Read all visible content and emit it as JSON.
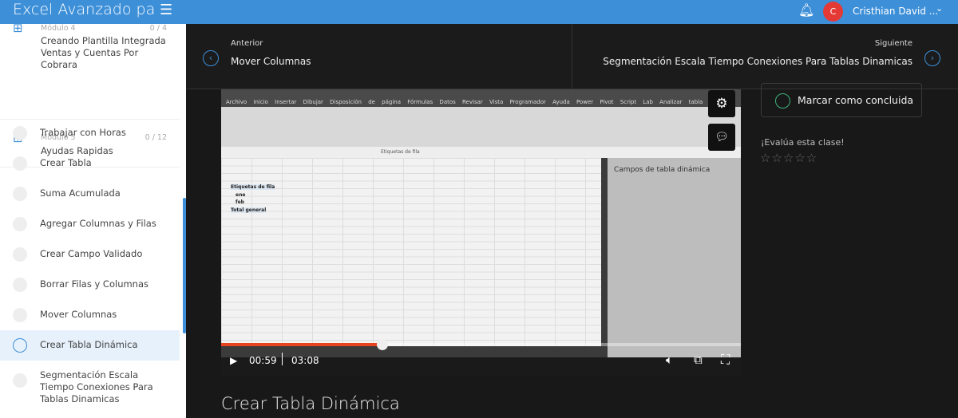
{
  "header": {
    "course_title": "Excel Avanzado para Administrativos",
    "user_initial": "C",
    "user_name": "Cristhian David ..."
  },
  "sidebar": {
    "modules": [
      {
        "label": "Módulo 4",
        "count": "0 / 4",
        "title": "Creando Plantilla Integrada Ventas y Cuentas Por Cobrara"
      },
      {
        "label": "Módulo 5",
        "count": "0 / 12",
        "title": "Ayudas Rapidas"
      }
    ],
    "lessons": [
      {
        "title": "Trabajar con Horas"
      },
      {
        "title": "Crear Tabla"
      },
      {
        "title": "Suma Acumulada"
      },
      {
        "title": "Agregar Columnas y Filas"
      },
      {
        "title": "Crear Campo Validado"
      },
      {
        "title": "Borrar Filas y Columnas"
      },
      {
        "title": "Mover Columnas"
      },
      {
        "title": "Crear Tabla Dinámica",
        "active": true
      },
      {
        "title": "Segmentación Escala Tiempo Conexiones Para Tablas Dinamicas"
      }
    ]
  },
  "nav": {
    "prev_label": "Anterior",
    "prev_title": "Mover Columnas",
    "next_label": "Siguiente",
    "next_title": "Segmentación Escala Tiempo Conexiones Para Tablas Dinamicas"
  },
  "video": {
    "ribbon_tabs": "Archivo Inicio Insertar Dibujar Disposición de página Fórmulas Datos Revisar Vista Programador Ayuda Power Pivot Script Lab Analizar tabla dinámica Diseño ¿Qué desea hacer?",
    "formula_bar": "Etiquetas de fila",
    "cells": [
      "Etiquetas de fila",
      "ene",
      "feb",
      "Total general"
    ],
    "pivot_title": "Campos de tabla dinámica",
    "current_time": "00:59",
    "duration": "03:08",
    "progress": 0.31
  },
  "lesson": {
    "mark_complete": "Marcar como concluida",
    "rate_label": "¡Evalúa esta clase!",
    "rating": 0,
    "title": "Crear Tabla Dinámica"
  }
}
